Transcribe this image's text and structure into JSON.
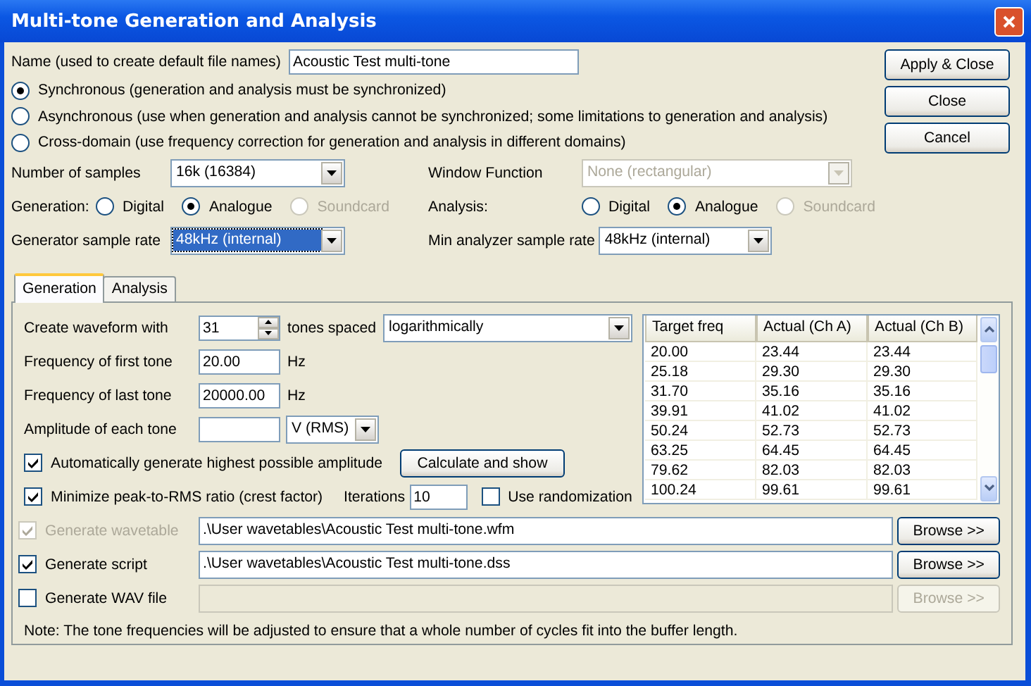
{
  "window": {
    "title": "Multi-tone Generation and Analysis"
  },
  "name_field": {
    "label": "Name (used to create default file names)",
    "value": "Acoustic Test multi-tone"
  },
  "buttons": [
    {
      "label": "Apply & Close"
    },
    {
      "label": "Close"
    },
    {
      "label": "Cancel"
    }
  ],
  "sync_modes": [
    {
      "label": "Synchronous (generation and analysis must be synchronized)",
      "selected": true
    },
    {
      "label": "Asynchronous (use when generation and analysis cannot be synchronized; some limitations to generation and analysis)",
      "selected": false
    },
    {
      "label": "Cross-domain (use frequency correction for generation and analysis in different domains)",
      "selected": false
    }
  ],
  "number_of_samples": {
    "label": "Number of samples",
    "value": "16k (16384)",
    "disabled": false,
    "focused": false
  },
  "window_function": {
    "label": "Window Function",
    "value": "None (rectangular)",
    "disabled": true,
    "focused": false
  },
  "generation": {
    "label": "Generation:",
    "options": [
      {
        "label": "Digital",
        "selected": false,
        "disabled": false
      },
      {
        "label": "Analogue",
        "selected": true,
        "disabled": false
      },
      {
        "label": "Soundcard",
        "selected": false,
        "disabled": true
      }
    ]
  },
  "analysis": {
    "label": "Analysis:",
    "options": [
      {
        "label": "Digital",
        "selected": false,
        "disabled": false
      },
      {
        "label": "Analogue",
        "selected": true,
        "disabled": false
      },
      {
        "label": "Soundcard",
        "selected": false,
        "disabled": true
      }
    ]
  },
  "generator_sample_rate": {
    "label": "Generator sample rate",
    "value": "48kHz (internal)",
    "disabled": false,
    "focused": true
  },
  "min_analyzer_sample_rate": {
    "label": "Min analyzer sample rate",
    "value": "48kHz (internal)",
    "disabled": false,
    "focused": false
  },
  "tabs": [
    {
      "label": "Generation",
      "selected": true
    },
    {
      "label": "Analysis",
      "selected": false
    }
  ],
  "waveform": {
    "label": "Create waveform with",
    "value": "31",
    "suffix": "tones spaced",
    "spacing": "logarithmically"
  },
  "tone_fields": [
    {
      "label": "Frequency of first tone",
      "value": "20.00",
      "unit": "Hz"
    },
    {
      "label": "Frequency of last tone",
      "value": "20000.00",
      "unit": "Hz"
    }
  ],
  "amplitude": {
    "label": "Amplitude of each tone",
    "unit": "V (RMS)"
  },
  "auto_amplitude": {
    "label": "Automatically generate highest possible amplitude",
    "checked": true
  },
  "calculate_button": "Calculate and show",
  "minimize": {
    "label": "Minimize peak-to-RMS ratio (crest factor)",
    "checked": true
  },
  "iterations": {
    "label": "Iterations",
    "value": "10"
  },
  "randomization": {
    "label": "Use randomization",
    "checked": false
  },
  "table": {
    "columns": [
      "Target freq",
      "Actual (Ch A)",
      "Actual (Ch B)"
    ],
    "rows": [
      [
        "20.00",
        "23.44",
        "23.44"
      ],
      [
        "25.18",
        "29.30",
        "29.30"
      ],
      [
        "31.70",
        "35.16",
        "35.16"
      ],
      [
        "39.91",
        "41.02",
        "41.02"
      ],
      [
        "50.24",
        "52.73",
        "52.73"
      ],
      [
        "63.25",
        "64.45",
        "64.45"
      ],
      [
        "79.62",
        "82.03",
        "82.03"
      ],
      [
        "100.24",
        "99.61",
        "99.61"
      ]
    ]
  },
  "outputs": [
    {
      "label": "Generate wavetable",
      "checked": true,
      "disabled": true,
      "path": ".\\User wavetables\\Acoustic Test multi-tone.wfm",
      "field_disabled": false,
      "browse": "Browse >>"
    },
    {
      "label": "Generate script",
      "checked": true,
      "disabled": false,
      "path": ".\\User wavetables\\Acoustic Test multi-tone.dss",
      "field_disabled": false,
      "browse": "Browse >>"
    },
    {
      "label": "Generate WAV file",
      "checked": false,
      "disabled": false,
      "field_disabled": true,
      "browse": "Browse >>"
    }
  ],
  "note": "Note: The tone frequencies will be adjusted to ensure that a whole number of cycles fit into the buffer length."
}
